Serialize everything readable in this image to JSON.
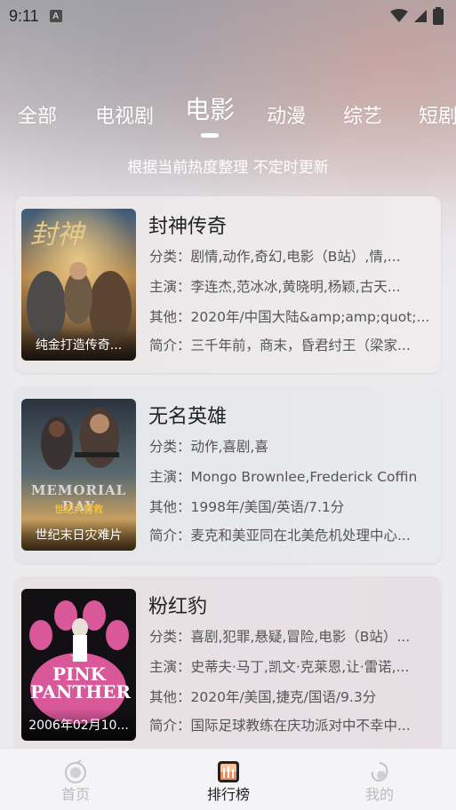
{
  "status_bar": {
    "time": "9:11",
    "notification_letter": "A"
  },
  "tabs": [
    {
      "label": "全部",
      "active": false
    },
    {
      "label": "电视剧",
      "active": false
    },
    {
      "label": "电影",
      "active": true
    },
    {
      "label": "动漫",
      "active": false
    },
    {
      "label": "综艺",
      "active": false
    },
    {
      "label": "短剧",
      "active": false
    }
  ],
  "subtitle": "根据当前热度整理 不定时更新",
  "movies": [
    {
      "title": "封神传奇",
      "poster_caption": "纯金打造传奇...",
      "poster_text": "封神",
      "category": "分类：剧情,动作,奇幻,电影（B站）,情,...",
      "cast": "主演：李连杰,范冰冰,黄晓明,杨颖,古天...",
      "other": "其他：2020年/中国大陆&amp;amp;quot;...",
      "intro": "简介：三千年前，商末，昏君纣王（梁家..."
    },
    {
      "title": "无名英雄",
      "poster_caption": "世纪末日灾难片",
      "poster_text": "MEMORIAL DAY",
      "poster_subtext": "世纪大营救",
      "category": "分类：动作,喜剧,喜",
      "cast": "主演：Mongo Brownlee,Frederick Coffin",
      "other": "其他：1998年/美国/英语/7.1分",
      "intro": "简介：麦克和美亚同在北美危机处理中心..."
    },
    {
      "title": "粉红豹",
      "poster_caption": "2006年02月10...",
      "poster_text": "PINK PANTHER",
      "poster_subtext": "THE",
      "category": "分类：喜剧,犯罪,悬疑,冒险,电影（B站）...",
      "cast": "主演：史蒂夫·马丁,凯文·克莱恩,让·雷诺,...",
      "other": "其他：2020年/美国,捷克/国语/9.3分",
      "intro": "简介：国际足球教练在庆功派对中不幸中..."
    }
  ],
  "bottom_nav": [
    {
      "label": "首页",
      "icon": "home-icon",
      "active": false
    },
    {
      "label": "排行榜",
      "icon": "ranking-icon",
      "active": true
    },
    {
      "label": "我的",
      "icon": "profile-icon",
      "active": false
    }
  ],
  "colors": {
    "accent": "#f08a5d",
    "active_text": "#222222",
    "inactive_text": "#bbbbbb"
  }
}
